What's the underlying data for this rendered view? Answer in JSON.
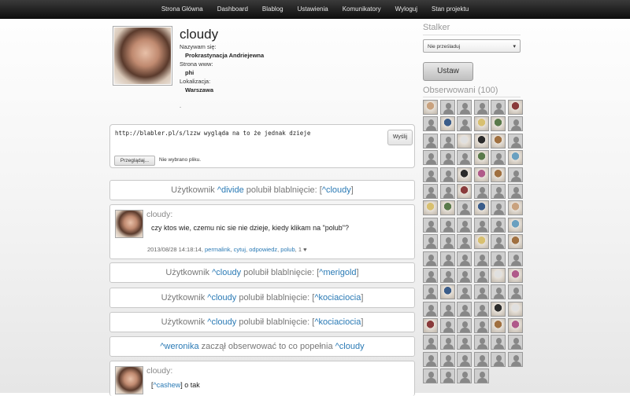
{
  "nav": [
    "Strona Główna",
    "Dashboard",
    "Blablog",
    "Ustawienia",
    "Komunikatory",
    "Wyloguj",
    "Stan projektu"
  ],
  "profile": {
    "username": "cloudy",
    "name_label": "Nazywam się:",
    "name_value": "Prokrastynacja Andriejewna",
    "www_label": "Strona www:",
    "www_value": "phi",
    "loc_label": "Lokalizacja:",
    "loc_value": "Warszawa",
    "dot": "."
  },
  "composer": {
    "text": "http://blabler.pl/s/lzzw wygląda na to że jednak dzieje",
    "send_label": "Wyślij",
    "browse_label": "Przeglądaj...",
    "no_file_label": "Nie wybrano pliku."
  },
  "feed": {
    "n1": {
      "a": "Użytkownik ",
      "u1": "^divide",
      "b": " polubił blablnięcie: [",
      "u2": "^cloudy",
      "c": "]"
    },
    "post1": {
      "author": "cloudy:",
      "body": "czy ktos wie, czemu nic sie nie dzieje, kiedy klikam na \"polub\"?",
      "date": "2013/08/28 14:18:14, ",
      "permalink": "permalink",
      "cytuj": "cytuj",
      "odpowiedz": "odpowiedz",
      "polub": "polub",
      "likes": ", 1 ♥"
    },
    "n2": {
      "a": "Użytkownik ",
      "u1": "^cloudy",
      "b": " polubił blablnięcie: [",
      "u2": "^merigold",
      "c": "]"
    },
    "n3": {
      "a": "Użytkownik ",
      "u1": "^cloudy",
      "b": " polubił blablnięcie: [",
      "u2": "^kociaciocia",
      "c": "]"
    },
    "n4": {
      "a": "Użytkownik ",
      "u1": "^cloudy",
      "b": " polubił blablnięcie: [",
      "u2": "^kociaciocia",
      "c": "]"
    },
    "n5": {
      "u1": "^weronika",
      "b": " zaczął obserwować to co popełnia ",
      "u2": "^cloudy"
    },
    "post2": {
      "author": "cloudy:",
      "mention": "^cashew",
      "body": " o tak"
    }
  },
  "sidebar": {
    "stalker_title": "Stalker",
    "select_value": "Nie prześladuj",
    "set_button": "Ustaw",
    "observed_title": "Obserwowani (100)"
  },
  "observed_avatar_count": 100,
  "colors": {
    "link": "#2a7ab5",
    "topbar": "#1a1a1a"
  }
}
